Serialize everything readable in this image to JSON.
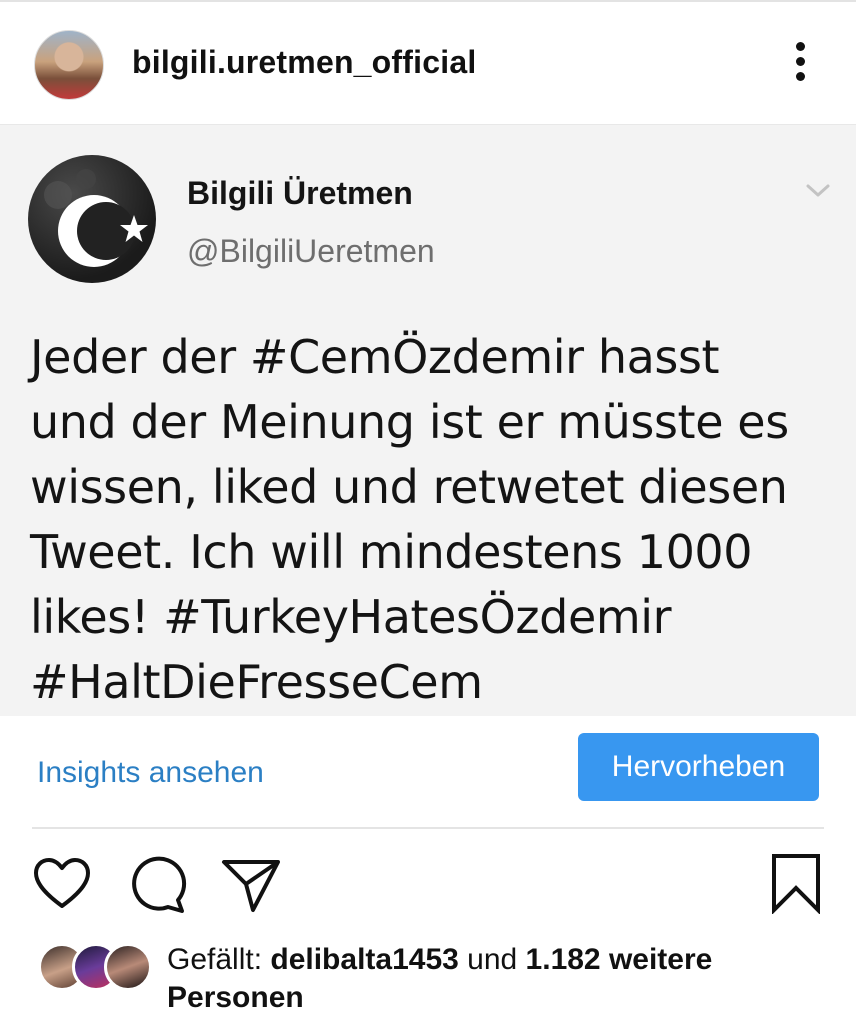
{
  "header": {
    "username": "bilgili.uretmen_official",
    "avatar_icon": "profile-photo",
    "more_icon": "more-vertical-icon"
  },
  "tweet": {
    "display_name": "Bilgili Üretmen",
    "handle": "@BilgiliUeretmen",
    "avatar_icon": "turkish-flag-crescent-star",
    "chevron_icon": "chevron-down-icon",
    "text_lines": [
      "Jeder der #CemÖzdemir hasst",
      "und der Meinung ist er müsste es",
      "wissen, liked und retwetet diesen",
      "Tweet. Ich will mindestens 1000",
      "likes! #TurkeyHatesÖzdemir",
      "#HaltDieFresseCem"
    ]
  },
  "actions": {
    "insights_label": "Insights ansehen",
    "promote_label": "Hervorheben",
    "accent_color": "#3897f0",
    "link_color": "#2b7fc4"
  },
  "engagement": {
    "icons": [
      "heart-icon",
      "comment-icon",
      "share-icon",
      "bookmark-icon"
    ],
    "likes_prefix": "Gefällt: ",
    "liker": "delibalta1453",
    "likes_connector": " und ",
    "likes_count_text": "1.182 weitere Personen"
  }
}
